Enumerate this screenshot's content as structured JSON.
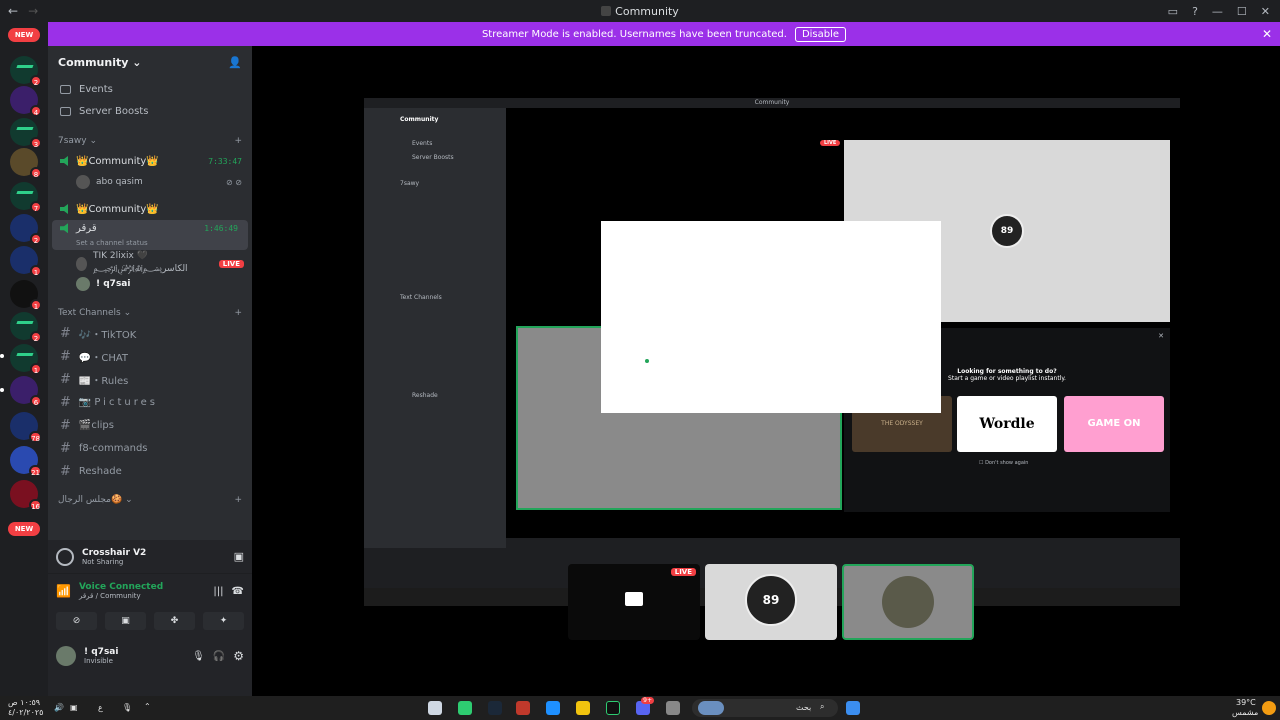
{
  "window": {
    "title": "Community"
  },
  "banner": {
    "text": "Streamer Mode is enabled. Usernames have been truncated.",
    "button": "Disable"
  },
  "servers": {
    "new_top": "NEW",
    "new_bottom": "NEW",
    "badges": [
      "2",
      "4",
      "3",
      "8",
      "7",
      "2",
      "1",
      "1",
      "2",
      "1",
      "6",
      "78",
      "21",
      "16"
    ]
  },
  "sidebar": {
    "guild_name": "Community",
    "nav": [
      "Events",
      "Server Boosts"
    ],
    "category_voice": "7sawy",
    "voice_channels": [
      {
        "name": "👑Community👑",
        "time": "7:33:47"
      },
      {
        "name": "👑Community👑"
      },
      {
        "name": "قرقر",
        "time": "1:46:49",
        "status": "Set a channel status"
      }
    ],
    "members_vc1": [
      {
        "name": "abo qasim"
      }
    ],
    "members_vc3": [
      {
        "name": "TIK 2lixix 🖤 ﷽الكاسر",
        "live": "LIVE"
      },
      {
        "name": "! q7sai"
      }
    ],
    "category_text": "Text Channels",
    "text_channels": [
      "🎶・TikTOK",
      "💬・CHAT",
      "📰・Rules",
      "📷Pictures",
      "🎬clips",
      "f8-commands",
      "Reshade"
    ],
    "category_bottom": "مجلس الرجال🍪"
  },
  "userpanel": {
    "activity_title": "Crosshair V2",
    "activity_sub": "Not Sharing",
    "voice_status": "Voice Connected",
    "voice_channel": "قرقر / Community",
    "username": "! q7sai",
    "user_status": "Invisible"
  },
  "stream": {
    "inner_title": "Community",
    "inner_live": "LIVE",
    "activity_prompt_1": "Looking for something to do?",
    "activity_prompt_2": "Start a game or video playlist instantly.",
    "activities": [
      "THE ODYSSEY",
      "Wordle",
      "GAME ON"
    ],
    "dont_show": "Don't show again",
    "avatar_label": "89"
  },
  "thumbnails": {
    "live_label": "LIVE"
  },
  "taskbar": {
    "time": "١٠:٥٩ ص",
    "date": "٤/٠٢/٢٠٢٥",
    "lang": "ع",
    "search_placeholder": "بحث",
    "weather_temp": "39°C",
    "weather_desc": "مشمس",
    "notif_count": "9+"
  },
  "colors": {
    "accent": "#9b30e8",
    "green": "#23a55a",
    "red": "#f23f43"
  }
}
